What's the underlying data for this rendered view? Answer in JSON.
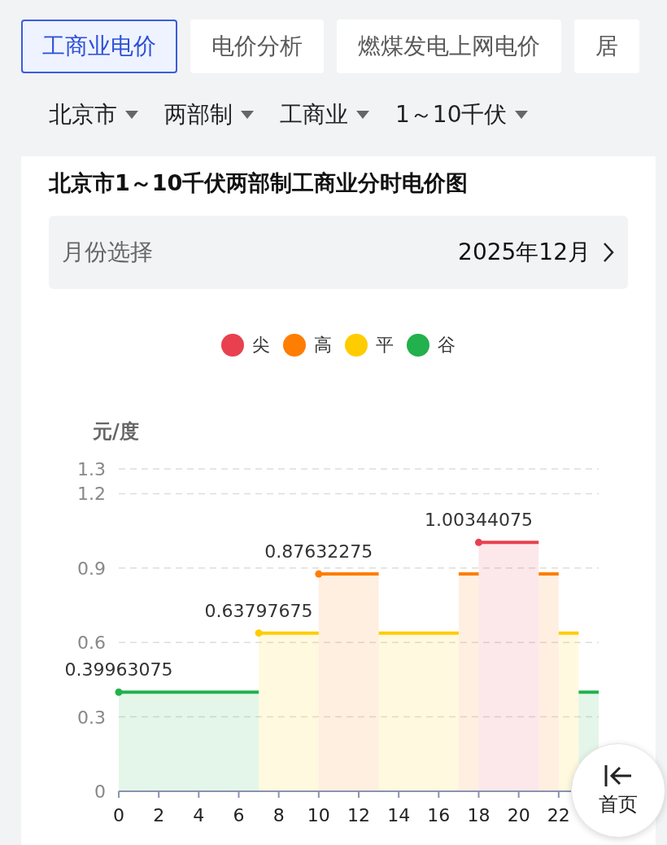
{
  "tabs": [
    {
      "label": "工商业电价",
      "selected": true
    },
    {
      "label": "电价分析",
      "selected": false
    },
    {
      "label": "燃煤发电上网电价",
      "selected": false
    },
    {
      "label": "居",
      "selected": false
    }
  ],
  "filters": [
    {
      "label": "北京市"
    },
    {
      "label": "两部制"
    },
    {
      "label": "工商业"
    },
    {
      "label": "1～10千伏"
    }
  ],
  "card": {
    "title": "北京市1～10千伏两部制工商业分时电价图",
    "month_picker": {
      "label": "月份选择",
      "value": "2025年12月"
    },
    "chart_data": {
      "type": "area",
      "ylabel": "元/度",
      "grid": true,
      "x": [
        0,
        1,
        2,
        3,
        4,
        5,
        6,
        7,
        8,
        9,
        10,
        11,
        12,
        13,
        14,
        15,
        16,
        17,
        18,
        19,
        20,
        21,
        22,
        23,
        24
      ],
      "xlim": [
        0,
        24
      ],
      "ylim": [
        0,
        1.3
      ],
      "xticks": [
        0,
        2,
        4,
        6,
        8,
        10,
        12,
        14,
        16,
        18,
        20,
        22
      ],
      "yticks": [
        0,
        0.3,
        0.6,
        0.9,
        1.2,
        1.3
      ],
      "series": [
        {
          "name": "尖",
          "color": "#e8404f",
          "values": [
            null,
            null,
            null,
            null,
            null,
            null,
            null,
            null,
            null,
            null,
            null,
            null,
            null,
            null,
            null,
            null,
            null,
            null,
            1.00344075,
            1.00344075,
            1.00344075,
            1.00344075,
            null,
            null,
            null
          ]
        },
        {
          "name": "高",
          "color": "#ff7d00",
          "values": [
            null,
            null,
            null,
            null,
            null,
            null,
            null,
            null,
            null,
            null,
            0.87632275,
            0.87632275,
            0.87632275,
            0.87632275,
            null,
            null,
            null,
            0.87632275,
            0.87632275,
            null,
            null,
            0.87632275,
            0.87632275,
            null,
            null
          ]
        },
        {
          "name": "平",
          "color": "#ffcc00",
          "values": [
            null,
            null,
            null,
            null,
            null,
            null,
            null,
            0.63797675,
            0.63797675,
            0.63797675,
            0.63797675,
            null,
            null,
            0.63797675,
            0.63797675,
            0.63797675,
            0.63797675,
            0.63797675,
            null,
            null,
            null,
            null,
            0.63797675,
            0.63797675,
            null
          ]
        },
        {
          "name": "谷",
          "color": "#22b14c",
          "values": [
            0.39963075,
            0.39963075,
            0.39963075,
            0.39963075,
            0.39963075,
            0.39963075,
            0.39963075,
            0.39963075,
            null,
            null,
            null,
            null,
            null,
            null,
            null,
            null,
            null,
            null,
            null,
            null,
            null,
            null,
            null,
            0.39963075,
            0.39963075
          ]
        }
      ],
      "annotations": [
        {
          "x": 0,
          "y": 0.39963075,
          "text": "0.39963075"
        },
        {
          "x": 7,
          "y": 0.63797675,
          "text": "0.63797675"
        },
        {
          "x": 10,
          "y": 0.87632275,
          "text": "0.87632275"
        },
        {
          "x": 18,
          "y": 1.00344075,
          "text": "1.00344075"
        }
      ]
    }
  },
  "home_button": {
    "label": "首页"
  }
}
